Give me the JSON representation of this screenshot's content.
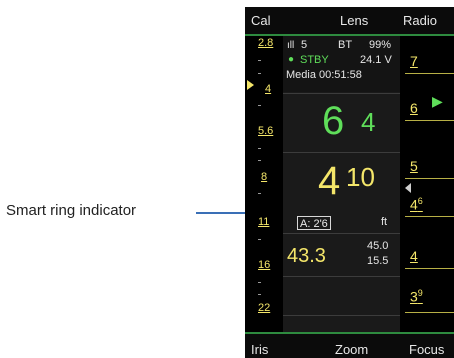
{
  "callout": {
    "label": "Smart ring indicator"
  },
  "topbar": {
    "left": "Cal",
    "center": "Lens",
    "right": "Radio"
  },
  "bottombar": {
    "left": "Iris",
    "center": "Zoom",
    "right": "Focus"
  },
  "iris_scale": {
    "ticks": [
      "2.8",
      "4",
      "5.6",
      "8",
      "11",
      "16",
      "22"
    ]
  },
  "status": {
    "signal": "5",
    "bt": "BT",
    "battery": "99%",
    "state": "STBY",
    "voltage": "24.1 V",
    "media": "Media 00:51:58"
  },
  "iris_readout": {
    "main": "6",
    "fraction": "4"
  },
  "focus_readout": {
    "main": "4",
    "fraction": "10",
    "ring_indicator": "A: 2'6",
    "unit": "ft"
  },
  "zoom_readout": {
    "main": "43.3",
    "upper": "45.0",
    "lower": "15.5"
  },
  "focus_scale": {
    "ticks": [
      "7",
      "6",
      "5",
      "4",
      "3"
    ],
    "marks_46": "4",
    "marks_46_sup": "6",
    "marks_39": "3",
    "marks_39_sup": "9"
  },
  "colors": {
    "accent_yellow": "#f4e66a",
    "status_green": "#5fde5a",
    "frame_green": "#2e8b3f"
  }
}
